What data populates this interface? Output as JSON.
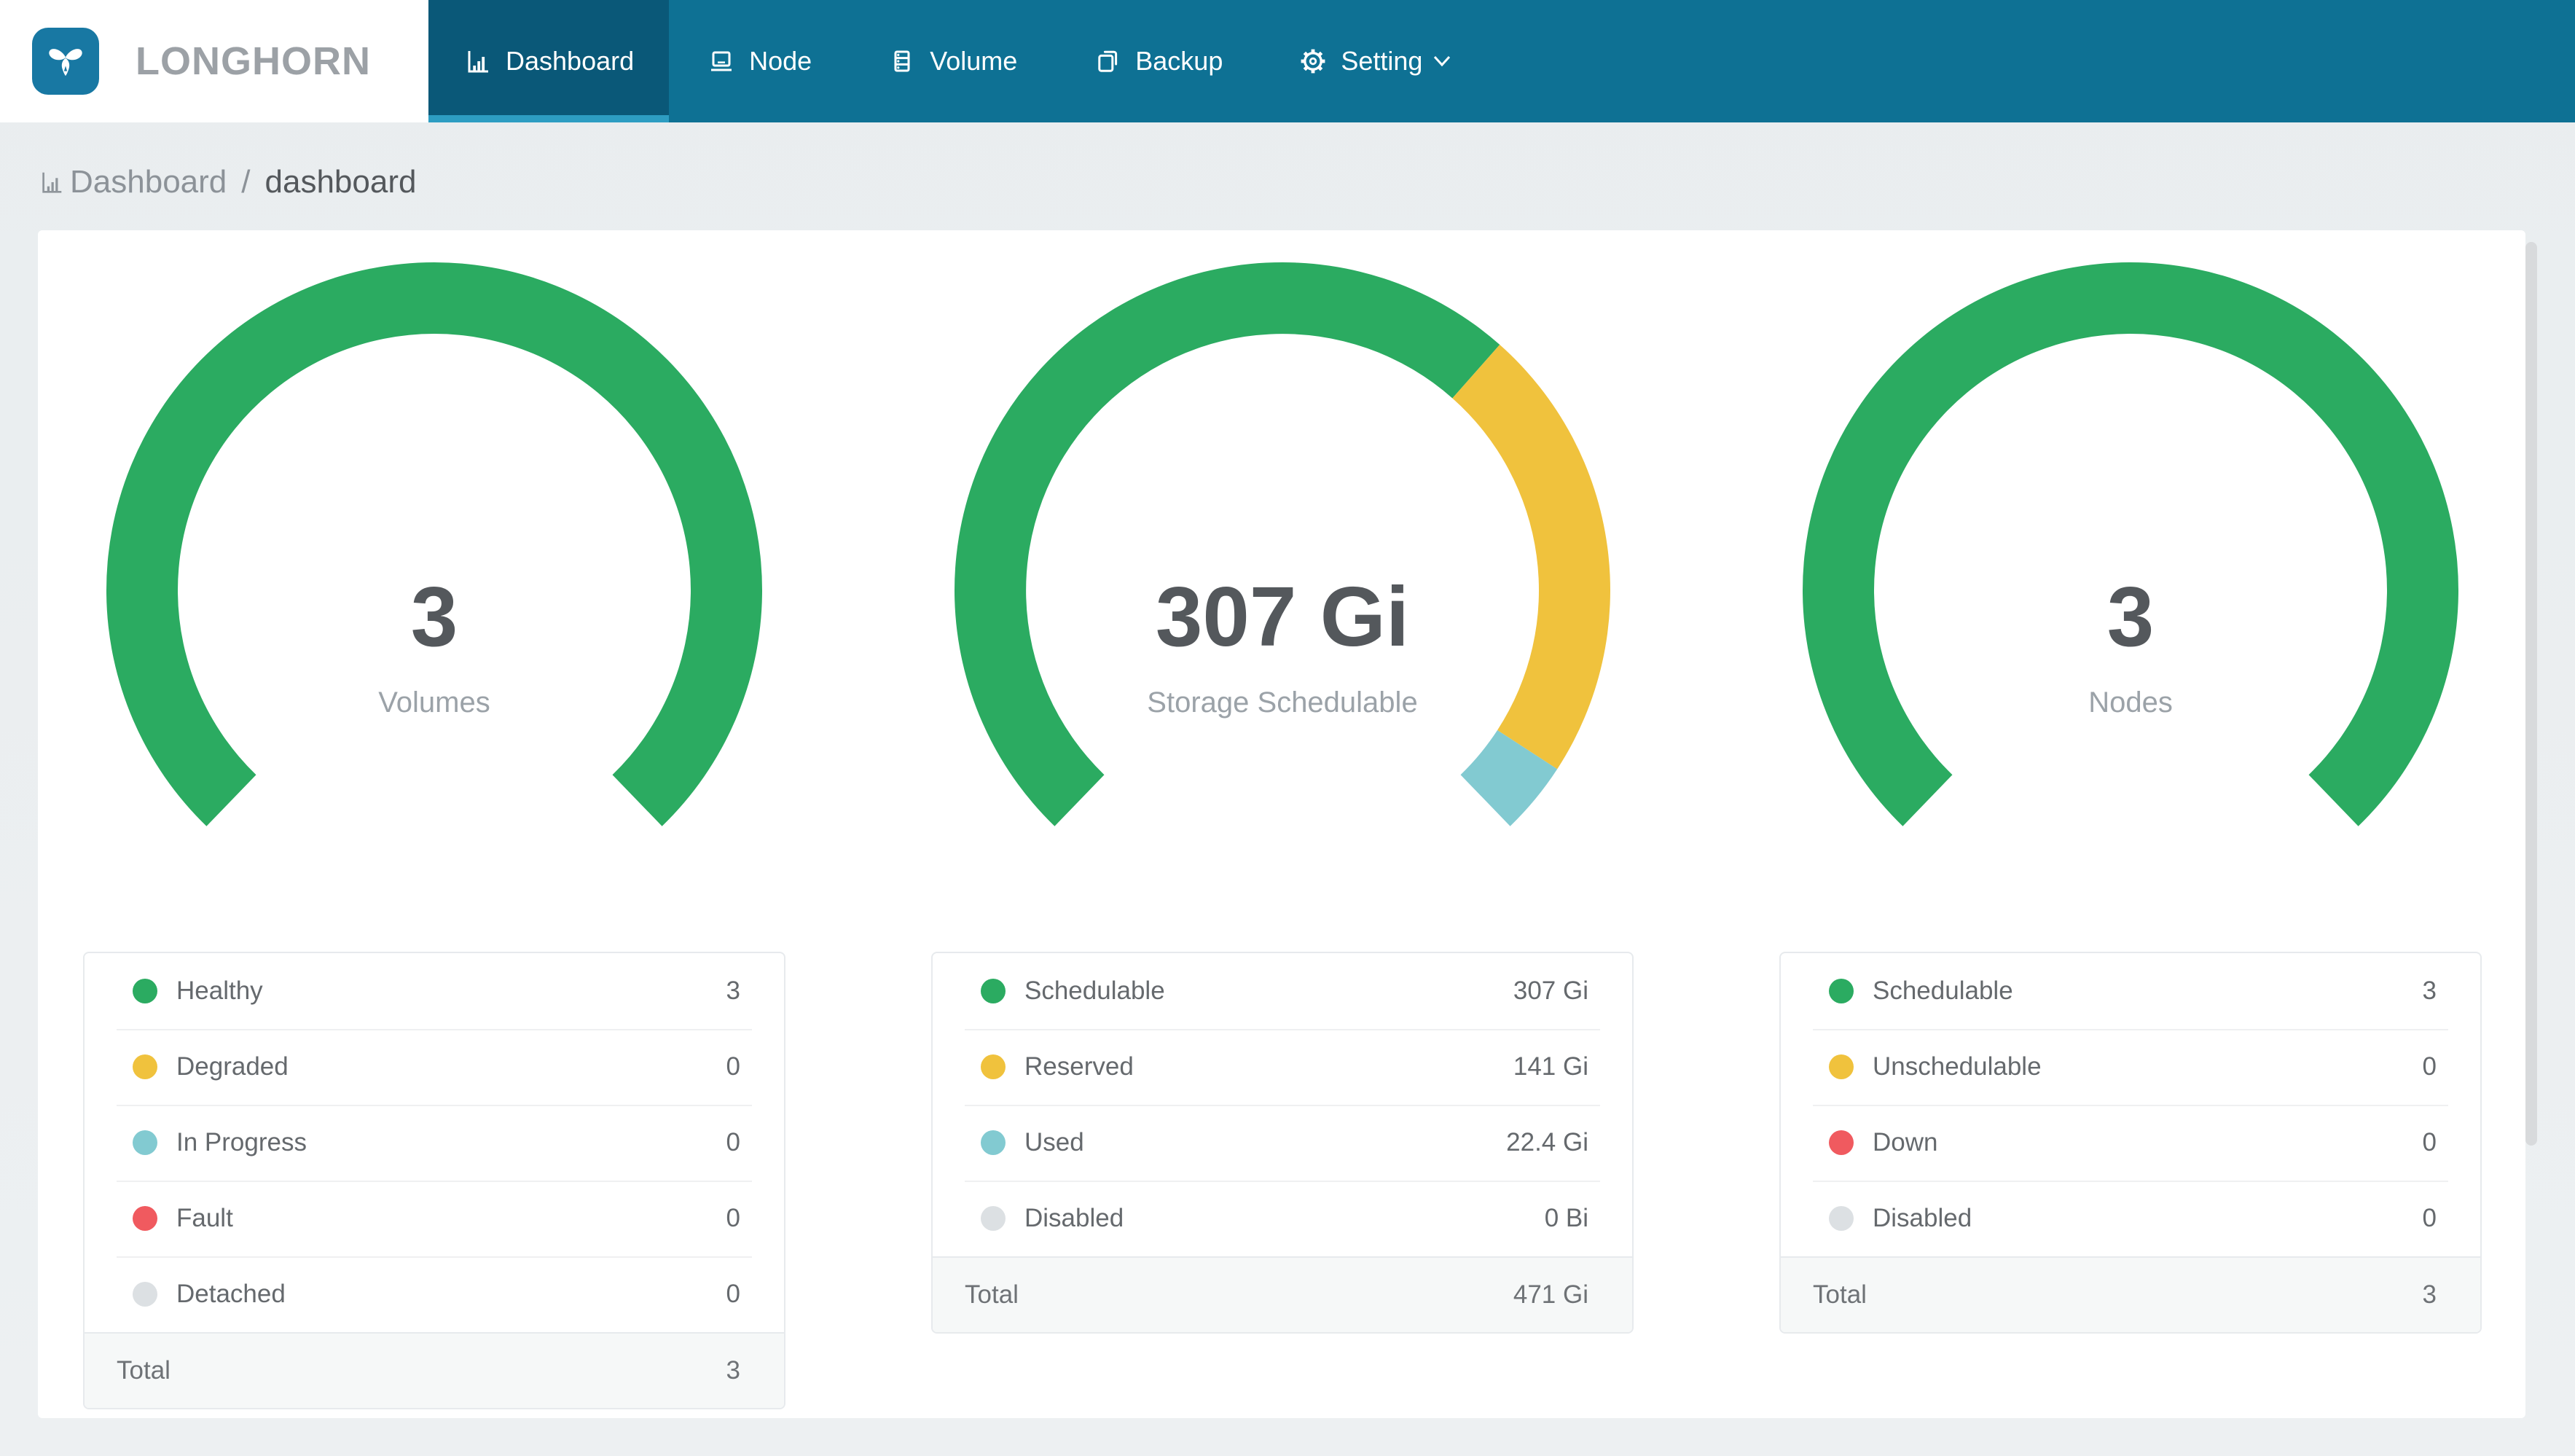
{
  "header": {
    "brand": "LONGHORN",
    "nav": [
      {
        "label": "Dashboard",
        "icon": "dashboard-icon",
        "active": true
      },
      {
        "label": "Node",
        "icon": "node-icon",
        "active": false
      },
      {
        "label": "Volume",
        "icon": "volume-icon",
        "active": false
      },
      {
        "label": "Backup",
        "icon": "backup-icon",
        "active": false
      },
      {
        "label": "Setting",
        "icon": "gear-icon",
        "active": false,
        "has_dropdown": true
      }
    ]
  },
  "breadcrumb": {
    "root": "Dashboard",
    "separator": "/",
    "current": "dashboard"
  },
  "chart_data": [
    {
      "type": "pie",
      "variant": "gauge-donut",
      "center_value": "3",
      "center_label": "Volumes",
      "arc": {
        "start_angle_deg": 224,
        "sweep_deg": 272
      },
      "segments": [
        {
          "label": "Healthy",
          "value": 3,
          "display": "3",
          "color": "#2BAB61"
        },
        {
          "label": "Degraded",
          "value": 0,
          "display": "0",
          "color": "#F0C23D"
        },
        {
          "label": "In Progress",
          "value": 0,
          "display": "0",
          "color": "#82CAD1"
        },
        {
          "label": "Fault",
          "value": 0,
          "display": "0",
          "color": "#F05A5F"
        },
        {
          "label": "Detached",
          "value": 0,
          "display": "0",
          "color": "#DCE0E3"
        }
      ],
      "total": {
        "label": "Total",
        "display": "3"
      }
    },
    {
      "type": "pie",
      "variant": "gauge-donut",
      "center_value": "307 Gi",
      "center_label": "Storage Schedulable",
      "arc": {
        "start_angle_deg": 224,
        "sweep_deg": 272
      },
      "segments": [
        {
          "label": "Schedulable",
          "value": 307,
          "display": "307 Gi",
          "color": "#2BAB61"
        },
        {
          "label": "Reserved",
          "value": 141,
          "display": "141 Gi",
          "color": "#F0C23D"
        },
        {
          "label": "Used",
          "value": 22.4,
          "display": "22.4 Gi",
          "color": "#82CAD1"
        },
        {
          "label": "Disabled",
          "value": 0,
          "display": "0 Bi",
          "color": "#DCE0E3"
        }
      ],
      "total": {
        "label": "Total",
        "display": "471 Gi"
      }
    },
    {
      "type": "pie",
      "variant": "gauge-donut",
      "center_value": "3",
      "center_label": "Nodes",
      "arc": {
        "start_angle_deg": 224,
        "sweep_deg": 272
      },
      "segments": [
        {
          "label": "Schedulable",
          "value": 3,
          "display": "3",
          "color": "#2BAB61"
        },
        {
          "label": "Unschedulable",
          "value": 0,
          "display": "0",
          "color": "#F0C23D"
        },
        {
          "label": "Down",
          "value": 0,
          "display": "0",
          "color": "#F05A5F"
        },
        {
          "label": "Disabled",
          "value": 0,
          "display": "0",
          "color": "#DCE0E3"
        }
      ],
      "total": {
        "label": "Total",
        "display": "3"
      }
    }
  ],
  "colors": {
    "navbar": "#0E7194",
    "navbar_active": "#0A5878",
    "active_indicator": "#2D9DC2",
    "logo_tile": "#1878A3",
    "green": "#2BAB61",
    "yellow": "#F0C23D",
    "teal": "#82CAD1",
    "red": "#F05A5F",
    "gray": "#DCE0E3"
  },
  "layout": {
    "gauge_centers_x": [
      272,
      854,
      1436
    ],
    "legend_lefts": [
      31,
      613,
      1195
    ]
  }
}
